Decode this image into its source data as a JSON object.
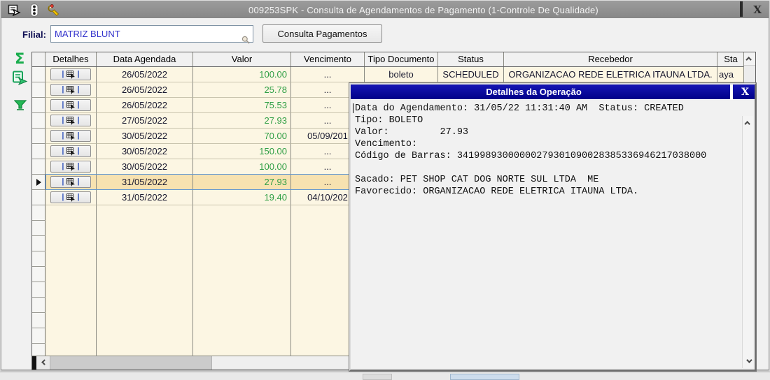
{
  "window": {
    "title": "009253SPK - Consulta de Agendamentos de Pagamento (1-Controle De Qualidade)",
    "titlebar_icons": [
      "export-form-icon",
      "traffic-light-icon",
      "wrench-icon"
    ],
    "controls": {
      "minimize": "minimize",
      "maximize": "maximize",
      "close": "X"
    }
  },
  "toolbar": {
    "filial_label": "Filial:",
    "filial_value": "MATRIZ BLUNT",
    "consulta_button": "Consulta Pagamentos"
  },
  "side_icons": {
    "sigma_glyph": "Σ",
    "names": [
      "sum-sigma-icon",
      "export-grid-icon",
      "filter-funnel-icon"
    ]
  },
  "grid": {
    "columns": [
      "Detalhes",
      "Data Agendada",
      "Valor",
      "Vencimento",
      "Tipo Documento",
      "Status",
      "Recebedor",
      "Sta"
    ],
    "rows": [
      {
        "data_agendada": "26/05/2022",
        "valor": "100.00",
        "vencimento": "...",
        "tipo": "boleto",
        "status": "SCHEDULED",
        "recebedor": "ORGANIZACAO REDE ELETRICA ITAUNA LTDA.",
        "sta": "aya"
      },
      {
        "data_agendada": "26/05/2022",
        "valor": "25.78",
        "vencimento": "..."
      },
      {
        "data_agendada": "26/05/2022",
        "valor": "75.53",
        "vencimento": "..."
      },
      {
        "data_agendada": "27/05/2022",
        "valor": "27.93",
        "vencimento": "..."
      },
      {
        "data_agendada": "30/05/2022",
        "valor": "70.00",
        "vencimento": "05/09/201"
      },
      {
        "data_agendada": "30/05/2022",
        "valor": "150.00",
        "vencimento": "..."
      },
      {
        "data_agendada": "30/05/2022",
        "valor": "100.00",
        "vencimento": "..."
      },
      {
        "data_agendada": "31/05/2022",
        "valor": "27.93",
        "vencimento": "...",
        "selected": true
      },
      {
        "data_agendada": "31/05/2022",
        "valor": "19.40",
        "vencimento": "04/10/202"
      }
    ],
    "empty_row_count": 10
  },
  "dialog": {
    "title": "Detalhes da Operação",
    "lines": [
      "Data do Agendamento: 31/05/22 11:31:40 AM  Status: CREATED",
      "Tipo: BOLETO",
      "Valor:         27.93",
      "Vencimento:",
      "Código de Barras: 34199893000000279301090028385336946217038000",
      "",
      "Sacado: PET SHOP CAT DOG NORTE SUL LTDA  ME",
      "Favorecido: ORGANIZACAO REDE ELETRICA ITAUNA LTDA."
    ]
  },
  "colors": {
    "grid_body": "#FCF6E3",
    "selected_row": "#F7E2B0",
    "selection_border": "#5E96D2",
    "value_green": "#2F9E44",
    "dialog_titlebar": "#0A0AA0",
    "main_titlebar": "#8E8E8E",
    "input_text_blue": "#3333CC",
    "sidebar_green": "#19AD4D"
  }
}
